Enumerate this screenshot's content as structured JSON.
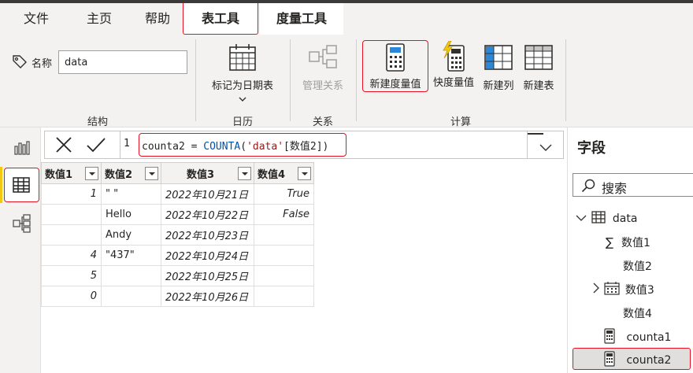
{
  "tabs": {
    "file": "文件",
    "home": "主页",
    "help": "帮助",
    "table_tools": "表工具",
    "measure_tools": "度量工具"
  },
  "ribbon": {
    "name_label": "名称",
    "name_value": "data",
    "mark_date_table": "标记为日期表",
    "manage_relationships": "管理关系",
    "new_measure": "新建度量值",
    "quick_measure": "快度量值",
    "new_column": "新建列",
    "new_table": "新建表",
    "groups": {
      "structure": "结构",
      "calendar": "日历",
      "relationships": "关系",
      "calculations": "计算"
    }
  },
  "formula": {
    "line_number": "1",
    "prefix": "counta2 = ",
    "function": "COUNTA",
    "open": "(",
    "table_ref": "'data'",
    "column_ref": "[数值2]",
    "close": ")"
  },
  "grid": {
    "headers": [
      "数值1",
      "数值2",
      "数值3",
      "数值4"
    ],
    "rows": [
      [
        "1",
        "\" \"",
        "2022年10月21日",
        "True"
      ],
      [
        "",
        "Hello",
        "2022年10月22日",
        "False"
      ],
      [
        "",
        "Andy",
        "2022年10月23日",
        ""
      ],
      [
        "4",
        "\"437\"",
        "2022年10月24日",
        ""
      ],
      [
        "5",
        "",
        "2022年10月25日",
        ""
      ],
      [
        "0",
        "",
        "2022年10月26日",
        ""
      ]
    ]
  },
  "fields_pane": {
    "title": "字段",
    "search_placeholder": "搜索",
    "table_name": "data",
    "items": [
      "数值1",
      "数值2",
      "数值3",
      "数值4",
      "counta1",
      "counta2"
    ]
  },
  "colors": {
    "highlight": "#e81123",
    "accent": "#f2c811",
    "formula_string": "#a31515",
    "formula_function": "#0451a5"
  }
}
